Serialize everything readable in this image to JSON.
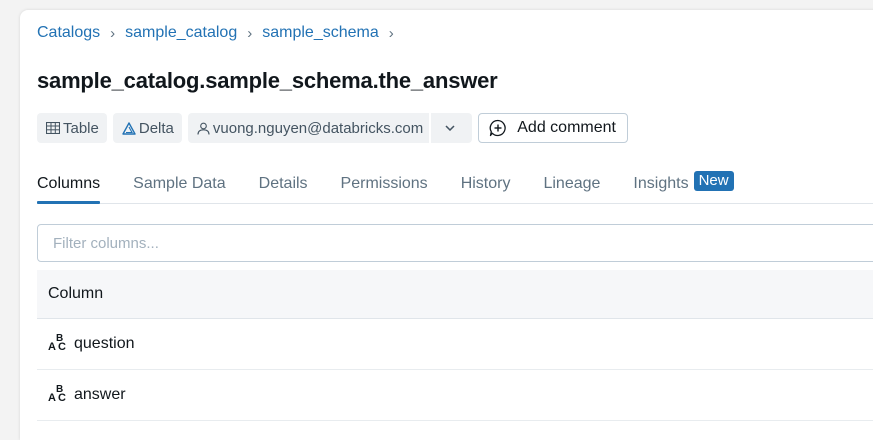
{
  "breadcrumb": {
    "items": [
      "Catalogs",
      "sample_catalog",
      "sample_schema"
    ],
    "separator": "›"
  },
  "page": {
    "title": "sample_catalog.sample_schema.the_answer"
  },
  "tags": {
    "type_label": "Table",
    "format_label": "Delta",
    "owner": "vuong.nguyen@databricks.com",
    "add_comment_label": "Add comment"
  },
  "tabs": [
    {
      "label": "Columns",
      "active": true
    },
    {
      "label": "Sample Data"
    },
    {
      "label": "Details"
    },
    {
      "label": "Permissions"
    },
    {
      "label": "History"
    },
    {
      "label": "Lineage"
    },
    {
      "label": "Insights",
      "badge": "New"
    }
  ],
  "filter": {
    "placeholder": "Filter columns...",
    "value": ""
  },
  "table": {
    "header": "Column",
    "rows": [
      {
        "name": "question",
        "type_icon": "string-type-icon"
      },
      {
        "name": "answer",
        "type_icon": "string-type-icon"
      }
    ]
  },
  "colors": {
    "accent": "#2272b4",
    "link": "#2272b4",
    "muted_text": "#5f7281",
    "tag_bg": "#f0f2f4"
  }
}
